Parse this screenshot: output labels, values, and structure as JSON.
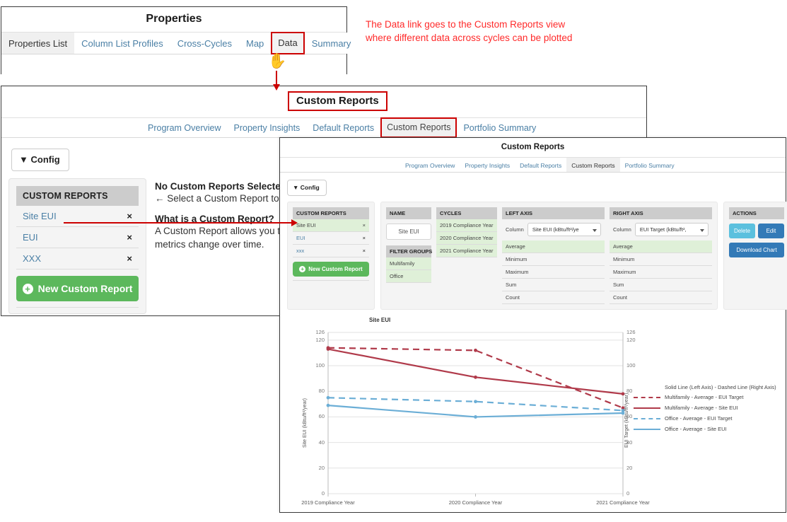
{
  "properties_window": {
    "title": "Properties",
    "tabs": [
      {
        "label": "Properties List",
        "state": "active"
      },
      {
        "label": "Column List Profiles",
        "state": "normal"
      },
      {
        "label": "Cross-Cycles",
        "state": "normal"
      },
      {
        "label": "Map",
        "state": "normal"
      },
      {
        "label": "Data",
        "state": "highlighted"
      },
      {
        "label": "Summary",
        "state": "normal"
      }
    ],
    "cursor_icon": "pointing-hand-cursor"
  },
  "annotation": {
    "text": "The Data link goes to the Custom Reports view\nwhere different data across cycles can be plotted",
    "color": "#ff2a2a"
  },
  "custom_reports_back": {
    "title": "Custom Reports",
    "tabs": [
      {
        "label": "Program Overview",
        "state": "normal"
      },
      {
        "label": "Property Insights",
        "state": "normal"
      },
      {
        "label": "Default Reports",
        "state": "normal"
      },
      {
        "label": "Custom Reports",
        "state": "highlighted"
      },
      {
        "label": "Portfolio Summary",
        "state": "normal"
      }
    ],
    "config_label": "Config",
    "custom_reports_panel": {
      "header": "CUSTOM REPORTS",
      "items": [
        {
          "label": "Site EUI",
          "remove": "×"
        },
        {
          "label": "EUI",
          "remove": "×"
        },
        {
          "label": "XXX",
          "remove": "×"
        }
      ],
      "new_button": "New Custom Report"
    },
    "empty_state": {
      "heading_1": "No Custom Reports Selected",
      "body_1": "← Select a Custom Report to g",
      "heading_2": "What is a Custom Report?",
      "body_2a": "A Custom Report allows you to",
      "body_2b": "metrics change over time."
    }
  },
  "custom_reports_front": {
    "title": "Custom Reports",
    "tabs": [
      {
        "label": "Program Overview",
        "state": "normal"
      },
      {
        "label": "Property Insights",
        "state": "normal"
      },
      {
        "label": "Default Reports",
        "state": "normal"
      },
      {
        "label": "Custom Reports",
        "state": "active"
      },
      {
        "label": "Portfolio Summary",
        "state": "normal"
      }
    ],
    "config_label": "Config",
    "columns": {
      "custom_reports": {
        "header": "CUSTOM REPORTS",
        "items": [
          {
            "label": "Site EUI",
            "remove": "×",
            "selected": true
          },
          {
            "label": "EUI",
            "remove": "×",
            "selected": false
          },
          {
            "label": "xxx",
            "remove": "×",
            "selected": false
          }
        ],
        "new_button": "New Custom Report"
      },
      "name": {
        "header": "NAME",
        "value": "Site EUI",
        "filter_groups_header": "FILTER GROUPS",
        "filter_groups": [
          "Multifamily",
          "Office"
        ]
      },
      "cycles": {
        "header": "CYCLES",
        "items": [
          "2019 Compliance Year",
          "2020 Compliance Year",
          "2021 Compliance Year"
        ]
      },
      "left_axis": {
        "header": "LEFT AXIS",
        "column_label": "Column",
        "column_value": "Site EUI (kBtu/ft²/ye",
        "aggregations": [
          "Average",
          "Minimum",
          "Maximum",
          "Sum",
          "Count"
        ],
        "selected_aggregation": "Average"
      },
      "right_axis": {
        "header": "RIGHT AXIS",
        "column_label": "Column",
        "column_value": "EUI Target (kBtu/ft²,",
        "aggregations": [
          "Average",
          "Minimum",
          "Maximum",
          "Sum",
          "Count"
        ],
        "selected_aggregation": "Average"
      },
      "actions": {
        "header": "ACTIONS",
        "delete": "Delete",
        "edit": "Edit",
        "download": "Download Chart"
      }
    }
  },
  "chart_data": {
    "type": "line",
    "title": "Site EUI",
    "xlabel": "",
    "ylabel": "Site EUI (kBtu/ft²/year)",
    "y2label": "EUI Target (kBtu/ft²/year)",
    "categories": [
      "2019 Compliance Year",
      "2020 Compliance Year",
      "2021 Compliance Year"
    ],
    "ylim": [
      0,
      126
    ],
    "y2lim": [
      0,
      126
    ],
    "yticks": [
      0,
      20,
      40,
      60,
      80,
      100,
      120,
      126
    ],
    "y2ticks": [
      0,
      20,
      40,
      60,
      80,
      100,
      120,
      126
    ],
    "grid": true,
    "legend_position": "right",
    "legend_title": "Solid Line (Left Axis) - Dashed Line (Right Axis)",
    "series": [
      {
        "name": "Multifamily - Average - EUI Target",
        "values": [
          114,
          112,
          67
        ],
        "color": "#b03a4a",
        "style": "dashed",
        "axis": "right"
      },
      {
        "name": "Multifamily - Average - Site EUI",
        "values": [
          113,
          91,
          78
        ],
        "color": "#b03a4a",
        "style": "solid",
        "axis": "left"
      },
      {
        "name": "Office - Average - EUI Target",
        "values": [
          75,
          72,
          65
        ],
        "color": "#6baed6",
        "style": "dashed",
        "axis": "right"
      },
      {
        "name": "Office - Average - Site EUI",
        "values": [
          69,
          60,
          63
        ],
        "color": "#6baed6",
        "style": "solid",
        "axis": "left"
      }
    ]
  }
}
